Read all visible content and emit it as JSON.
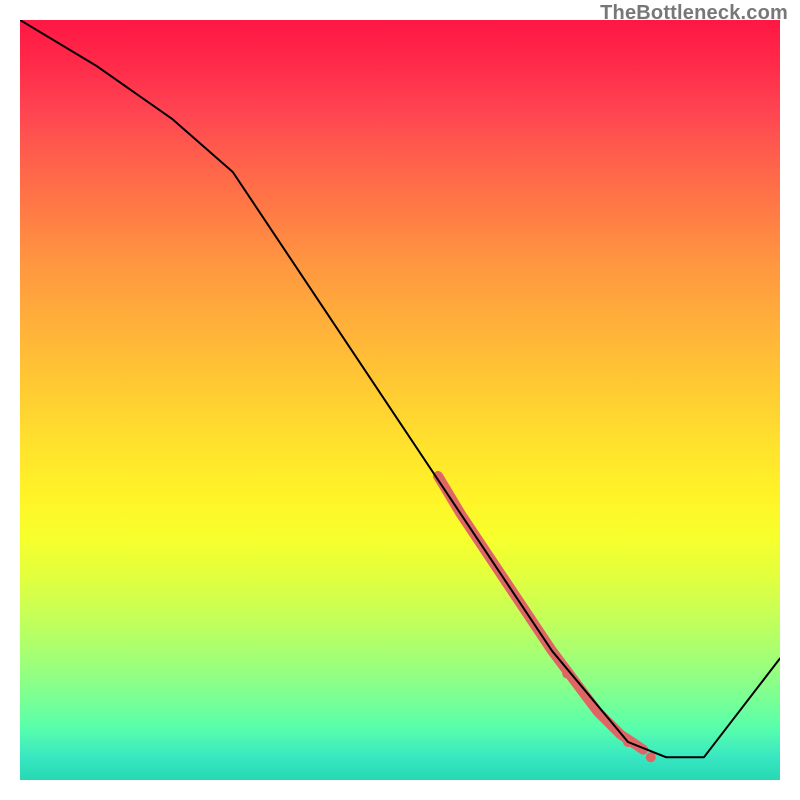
{
  "watermark": "TheBottleneck.com",
  "chart_data": {
    "type": "line",
    "title": "",
    "xlabel": "",
    "ylabel": "",
    "xlim": [
      0,
      100
    ],
    "ylim": [
      0,
      100
    ],
    "background_gradient": {
      "direction": "vertical",
      "stops": [
        {
          "pos": 0.0,
          "color": "#ff1744"
        },
        {
          "pos": 0.25,
          "color": "#ff7a45"
        },
        {
          "pos": 0.5,
          "color": "#ffe22d"
        },
        {
          "pos": 0.78,
          "color": "#c8ff55"
        },
        {
          "pos": 1.0,
          "color": "#26d9b3"
        }
      ]
    },
    "series": [
      {
        "name": "curve",
        "color": "#000000",
        "stroke_width": 2,
        "x": [
          0,
          10,
          20,
          28,
          40,
          50,
          60,
          70,
          80,
          85,
          90,
          100
        ],
        "y": [
          100,
          94,
          87,
          80,
          62,
          47,
          32,
          17,
          5,
          3,
          3,
          16
        ]
      }
    ],
    "highlight": {
      "name": "highlight-segment",
      "color": "#e06666",
      "stroke_width": 10,
      "x": [
        55,
        58,
        62,
        66,
        70,
        73,
        76,
        79,
        82
      ],
      "y": [
        40,
        35,
        29,
        23,
        17,
        13,
        9,
        6,
        4
      ]
    },
    "highlight_dots": {
      "name": "highlight-dots",
      "color": "#e06666",
      "radius": 5,
      "points": [
        {
          "x": 72,
          "y": 14
        },
        {
          "x": 80,
          "y": 5
        },
        {
          "x": 83,
          "y": 3
        }
      ]
    }
  }
}
